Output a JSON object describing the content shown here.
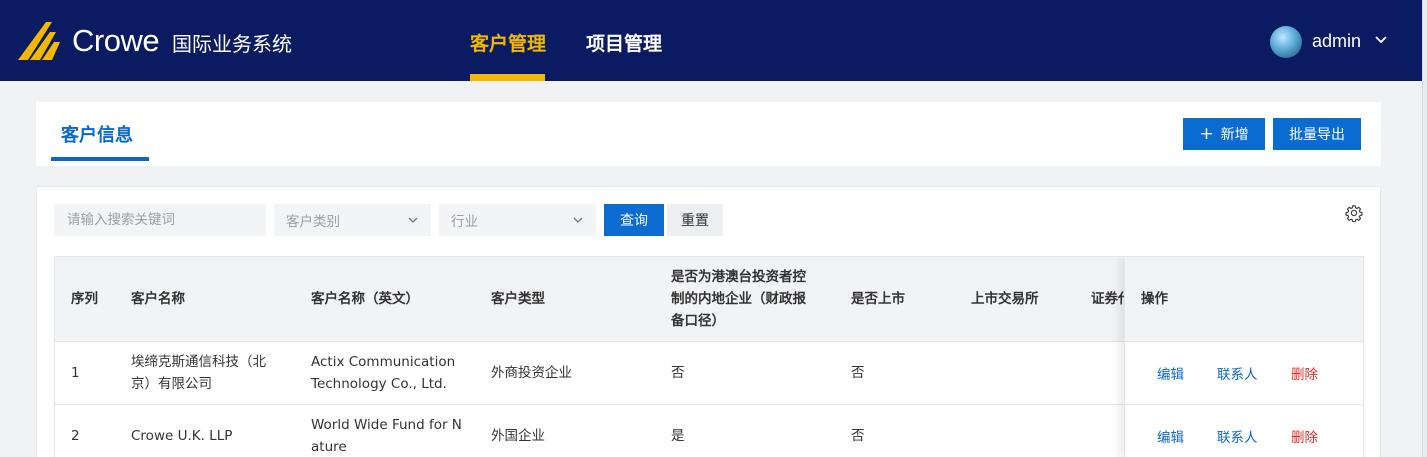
{
  "header": {
    "logo_text": "Crowe",
    "system_name": "国际业务系统",
    "nav": [
      {
        "label": "客户管理",
        "active": true
      },
      {
        "label": "项目管理",
        "active": false
      }
    ],
    "user": {
      "name": "admin"
    }
  },
  "title_card": {
    "title": "客户信息",
    "add_button": "新增",
    "export_button": "批量导出"
  },
  "filters": {
    "search_placeholder": "请输入搜索关键词",
    "customer_type_placeholder": "客户类别",
    "industry_placeholder": "行业",
    "query_button": "查询",
    "reset_button": "重置"
  },
  "table": {
    "columns": [
      "序列",
      "客户名称",
      "客户名称（英文）",
      "客户类型",
      "是否为港澳台投资者控制的内地企业（财政报备口径）",
      "是否上市",
      "上市交易所",
      "证券代码",
      "操作"
    ],
    "header_lines": {
      "hk_col": [
        "是否为港澳台投资者控",
        "制的内地企业（财政报",
        "备口径）"
      ],
      "securities_visible": "证券代"
    },
    "rows": [
      {
        "index": "1",
        "name_lines": [
          "埃缔克斯通信科技（北",
          "京）有限公司"
        ],
        "name_en_lines": [
          "Actix Communication",
          "Technology Co., Ltd."
        ],
        "type": "外商投资企业",
        "hk_controlled": "否",
        "listed": "否"
      },
      {
        "index": "2",
        "name_lines": [
          "Crowe U.K. LLP"
        ],
        "name_en_lines": [
          "World Wide Fund for N",
          "ature"
        ],
        "type": "外国企业",
        "hk_controlled": "是",
        "listed": "否"
      }
    ],
    "actions": {
      "edit": "编辑",
      "contacts": "联系人",
      "delete": "删除"
    }
  },
  "colors": {
    "header_bg": "#0b1b62",
    "accent_yellow": "#f5b800",
    "primary_blue": "#0a6cd1",
    "danger_red": "#e0302a"
  }
}
